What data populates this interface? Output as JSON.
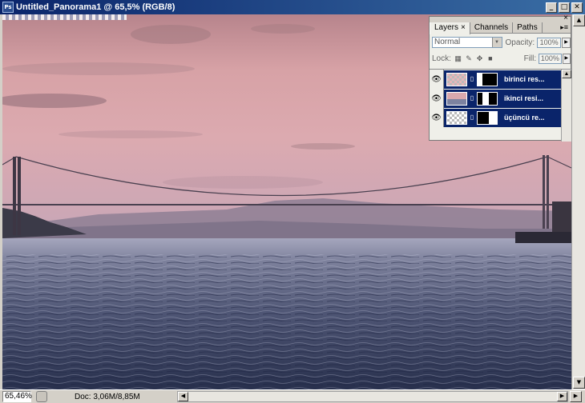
{
  "window": {
    "title": "Untitled_Panorama1 @ 65,5% (RGB/8)",
    "app_icon": "Ps",
    "minimize": "_",
    "maximize": "□",
    "close": "✕"
  },
  "status": {
    "zoom": "65,46%",
    "doc": "Doc: 3,06M/8,85M"
  },
  "layers_panel": {
    "tabs": [
      "Layers",
      "Channels",
      "Paths"
    ],
    "tab_close": "×",
    "blend_mode": "Normal",
    "opacity_label": "Opacity:",
    "opacity_value": "100%",
    "lock_label": "Lock:",
    "fill_label": "Fill:",
    "fill_value": "100%",
    "layers": [
      {
        "name": "birinci res...",
        "visible": true
      },
      {
        "name": "ikinci resi...",
        "visible": true
      },
      {
        "name": "üçüncü re...",
        "visible": true
      }
    ]
  },
  "colors": {
    "title_bar": "#0a246a",
    "layer_selected": "#0a246a",
    "sky_top": "#c9959b",
    "water": "#2a3350"
  }
}
